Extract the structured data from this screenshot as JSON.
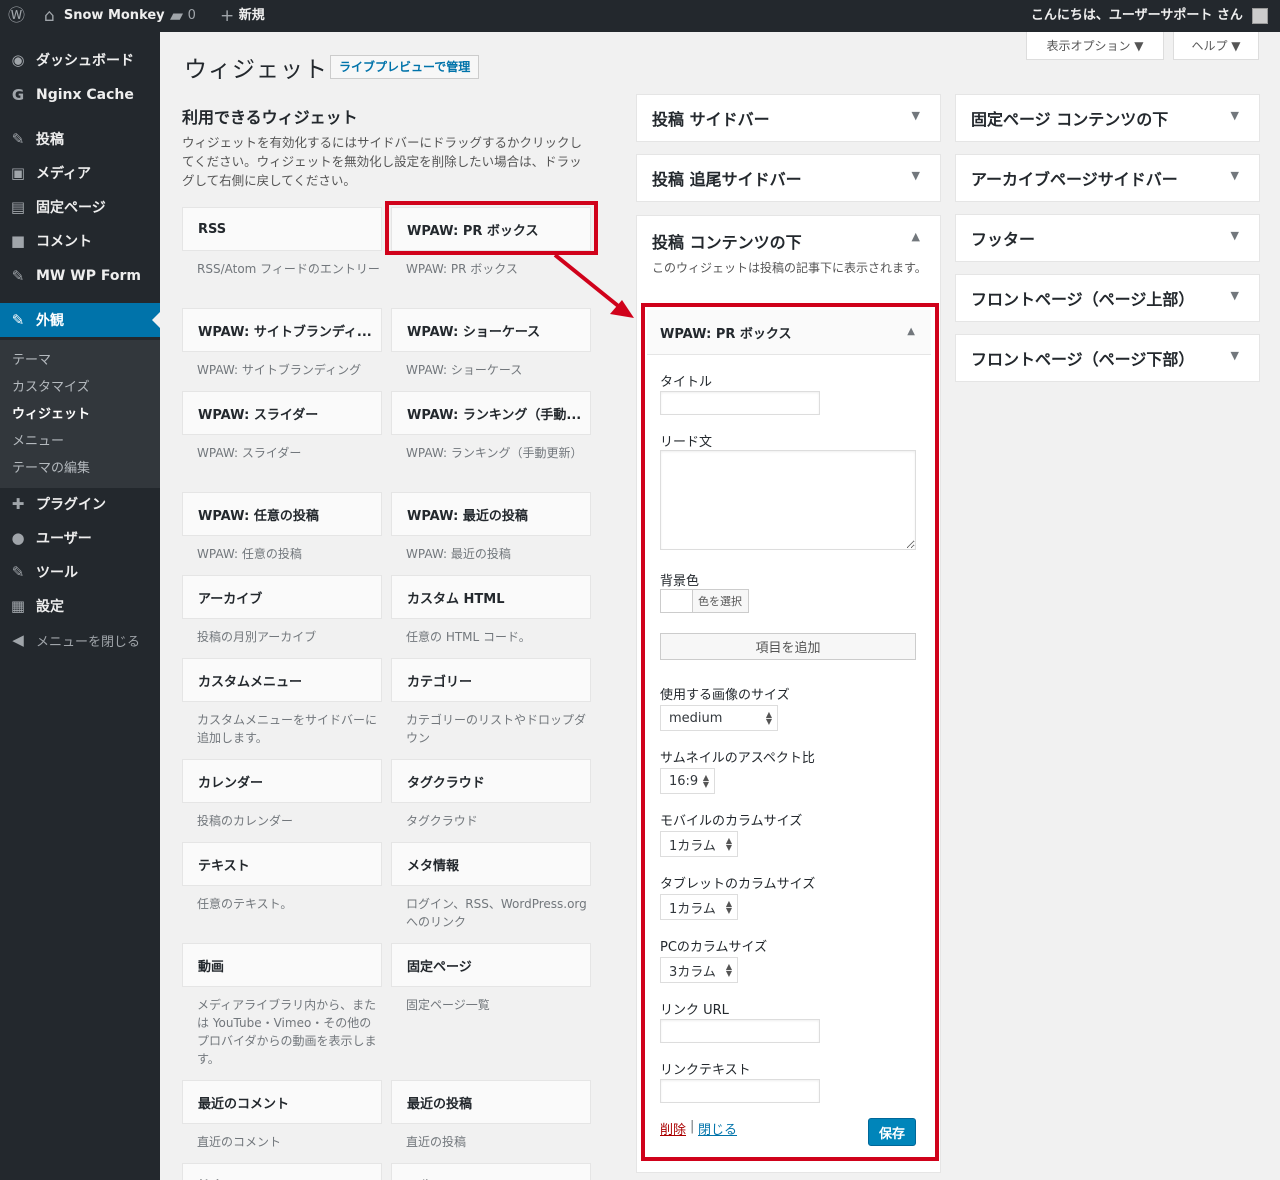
{
  "adminbar": {
    "site": "Snow Monkey",
    "comments": "0",
    "new": "新規",
    "greeting": "こんにちは、ユーザーサポート さん",
    "wp_icon": "wordpress-logo-icon",
    "home_icon": "home-icon",
    "comment_icon": "comment-icon",
    "plus_icon": "plus-icon"
  },
  "menu": [
    {
      "label": "ダッシュボード",
      "icon": "dashboard-icon",
      "glyph": "◉"
    },
    {
      "label": "Nginx Cache",
      "icon": "nginx-cache-icon",
      "glyph": "G"
    },
    {
      "label": "投稿",
      "icon": "pin-icon",
      "glyph": "✎"
    },
    {
      "label": "メディア",
      "icon": "media-icon",
      "glyph": "▣"
    },
    {
      "label": "固定ページ",
      "icon": "page-icon",
      "glyph": "▤"
    },
    {
      "label": "コメント",
      "icon": "comment-icon",
      "glyph": "■"
    },
    {
      "label": "MW WP Form",
      "icon": "form-icon",
      "glyph": "✎"
    },
    {
      "label": "外観",
      "icon": "brush-icon",
      "glyph": "✎"
    },
    {
      "label": "プラグイン",
      "icon": "plugin-icon",
      "glyph": "✚"
    },
    {
      "label": "ユーザー",
      "icon": "user-icon",
      "glyph": "●"
    },
    {
      "label": "ツール",
      "icon": "wrench-icon",
      "glyph": "✎"
    },
    {
      "label": "設定",
      "icon": "settings-icon",
      "glyph": "▦"
    },
    {
      "label": "メニューを閉じる",
      "icon": "collapse-icon",
      "glyph": "◀"
    }
  ],
  "submenu": [
    "テーマ",
    "カスタマイズ",
    "ウィジェット",
    "メニュー",
    "テーマの編集"
  ],
  "screen_options": "表示オプション ▼",
  "help": "ヘルプ ▼",
  "page": {
    "title": "ウィジェット",
    "live_preview": "ライブプレビューで管理"
  },
  "available": {
    "heading": "利用できるウィジェット",
    "desc": "ウィジェットを有効化するにはサイドバーにドラッグするかクリックしてください。ウィジェットを無効化し設定を削除したい場合は、ドラッグして右側に戻してください。"
  },
  "widgets": [
    {
      "title": "RSS",
      "desc": "RSS/Atom フィードのエントリー"
    },
    {
      "title": "WPAW: PR ボックス",
      "desc": "WPAW: PR ボックス"
    },
    {
      "title": "WPAW: サイトブランディ...",
      "desc": "WPAW: サイトブランディング"
    },
    {
      "title": "WPAW: ショーケース",
      "desc": "WPAW: ショーケース"
    },
    {
      "title": "WPAW: スライダー",
      "desc": "WPAW: スライダー"
    },
    {
      "title": "WPAW: ランキング（手動...",
      "desc": "WPAW: ランキング（手動更新）"
    },
    {
      "title": "WPAW: 任意の投稿",
      "desc": "WPAW: 任意の投稿"
    },
    {
      "title": "WPAW: 最近の投稿",
      "desc": "WPAW: 最近の投稿"
    },
    {
      "title": "アーカイブ",
      "desc": "投稿の月別アーカイブ"
    },
    {
      "title": "カスタム HTML",
      "desc": "任意の HTML コード。"
    },
    {
      "title": "カスタムメニュー",
      "desc": "カスタムメニューをサイドバーに追加します。"
    },
    {
      "title": "カテゴリー",
      "desc": "カテゴリーのリストやドロップダウン"
    },
    {
      "title": "カレンダー",
      "desc": "投稿のカレンダー"
    },
    {
      "title": "タグクラウド",
      "desc": "タグクラウド"
    },
    {
      "title": "テキスト",
      "desc": "任意のテキスト。"
    },
    {
      "title": "メタ情報",
      "desc": "ログイン、RSS、WordPress.org へのリンク"
    },
    {
      "title": "動画",
      "desc": "メディアライブラリ内から、または YouTube・Vimeo・その他のプロバイダからの動画を表示します。"
    },
    {
      "title": "固定ページ",
      "desc": "固定ページ一覧"
    },
    {
      "title": "最近のコメント",
      "desc": "直近のコメント"
    },
    {
      "title": "最近の投稿",
      "desc": "直近の投稿"
    },
    {
      "title": "検索",
      "desc": ""
    },
    {
      "title": "画像",
      "desc": ""
    }
  ],
  "sidebars_mid": [
    "投稿 サイドバー",
    "投稿 追尾サイドバー"
  ],
  "open_sidebar": {
    "title": "投稿 コンテンツの下",
    "desc": "このウィジェットは投稿の記事下に表示されます。"
  },
  "sidebars_right": [
    "固定ページ コンテンツの下",
    "アーカイブページサイドバー",
    "フッター",
    "フロントページ（ページ上部）",
    "フロントページ（ページ下部）"
  ],
  "form": {
    "widget_title": "WPAW: PR ボックス",
    "title_label": "タイトル",
    "lead_label": "リード文",
    "bg_label": "背景色",
    "color_button": "色を選択",
    "add_item": "項目を追加",
    "image_size_label": "使用する画像のサイズ",
    "image_size": "medium",
    "aspect_label": "サムネイルのアスペクト比",
    "aspect": "16:9",
    "mobile_label": "モバイルのカラムサイズ",
    "mobile": "1カラム",
    "tablet_label": "タブレットのカラムサイズ",
    "tablet": "1カラム",
    "pc_label": "PCのカラムサイズ",
    "pc": "3カラム",
    "link_url_label": "リンク URL",
    "link_text_label": "リンクテキスト",
    "delete": "削除",
    "sep": "|",
    "close": "閉じる",
    "save": "保存"
  },
  "colors": {
    "admin_bar": "#23282d",
    "menu_current": "#0073aa",
    "highlight": "#d0021b",
    "link": "#0073aa",
    "delete": "#a00"
  }
}
